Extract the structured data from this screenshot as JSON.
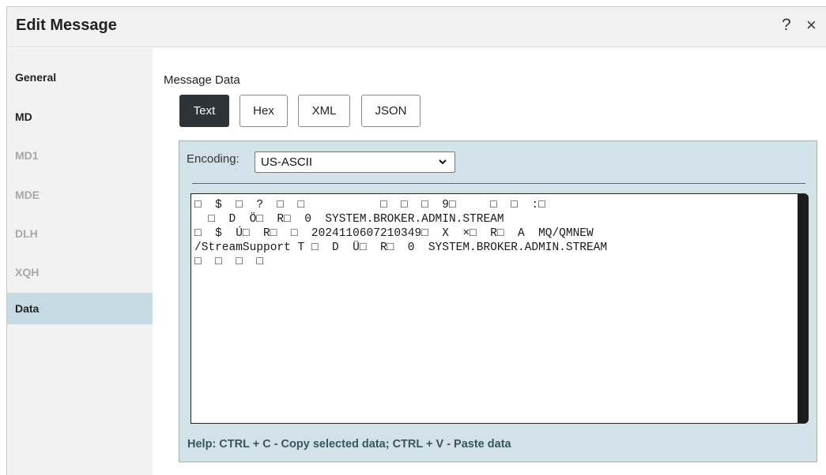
{
  "dialog": {
    "title": "Edit Message",
    "help_glyph": "?",
    "close_glyph": "×"
  },
  "sidebar": {
    "items": [
      {
        "label": "General",
        "state": "enabled"
      },
      {
        "label": "MD",
        "state": "enabled"
      },
      {
        "label": "MD1",
        "state": "disabled"
      },
      {
        "label": "MDE",
        "state": "disabled"
      },
      {
        "label": "DLH",
        "state": "disabled"
      },
      {
        "label": "XQH",
        "state": "disabled"
      },
      {
        "label": "Data",
        "state": "active"
      }
    ]
  },
  "main": {
    "section_label": "Message Data",
    "format_tabs": [
      {
        "label": "Text",
        "active": true
      },
      {
        "label": "Hex",
        "active": false
      },
      {
        "label": "XML",
        "active": false
      },
      {
        "label": "JSON",
        "active": false
      }
    ],
    "encoding_label": "Encoding:",
    "encoding_value": "US-ASCII",
    "encoding_options_icon": "chevron-down-icon",
    "data_lines": [
      "□  $  □  ?  □  □           □  □  □  9□     □  □  :□",
      "  □  D  Ö□  R□  0  SYSTEM.BROKER.ADMIN.STREAM",
      "□  $  Ú□  R□  □  2024110607210349□  X  ×□  R□  A  MQ/QMNEW",
      "/StreamSupport T □  D  Ü□  R□  0  SYSTEM.BROKER.ADMIN.STREAM",
      "□  □  □  □"
    ],
    "help_text": "Help: CTRL + C - Copy selected data; CTRL + V - Paste data"
  },
  "colors": {
    "active_tab_bg": "#2e3338",
    "active_nav_bg": "#c5dae3",
    "panel_bg": "#d3e2e8",
    "help_text": "#3a5560"
  }
}
